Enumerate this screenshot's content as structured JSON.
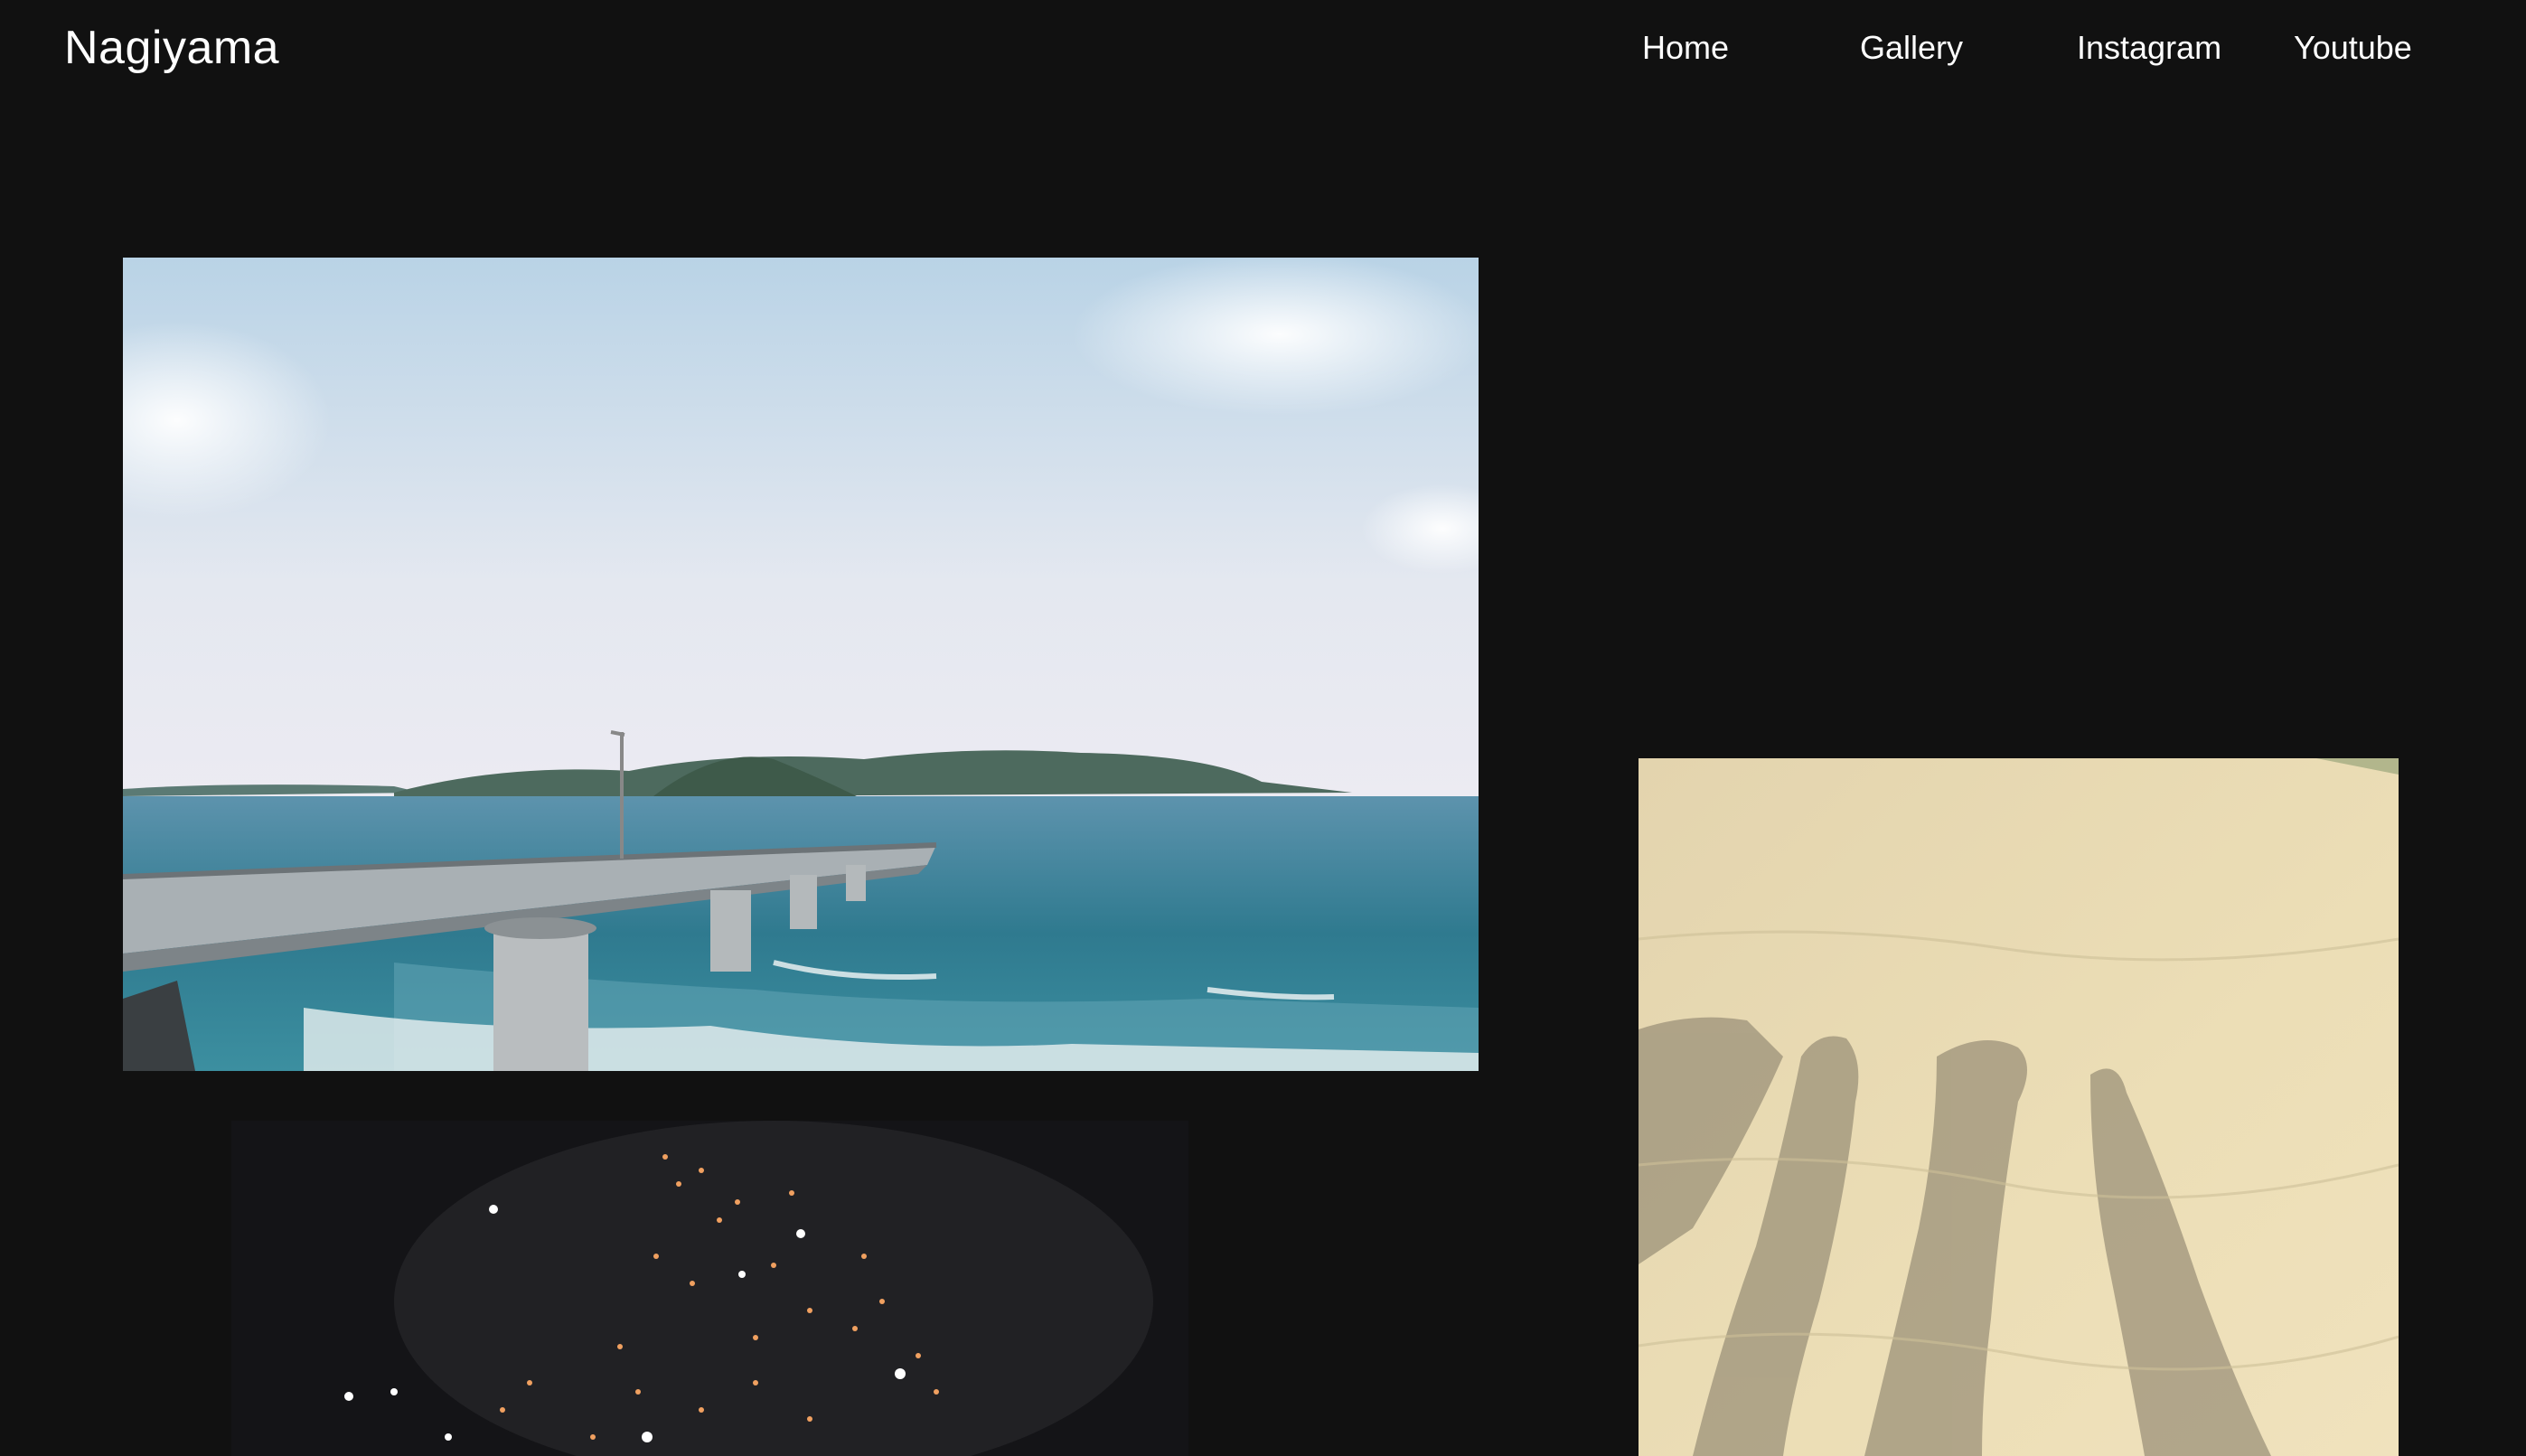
{
  "header": {
    "brand": "Nagiyama",
    "nav": [
      {
        "label": "Home"
      },
      {
        "label": "Gallery"
      },
      {
        "label": "Instagram"
      },
      {
        "label": "Youtube"
      }
    ]
  },
  "colors": {
    "background": "#111111",
    "text": "#ffffff"
  },
  "gallery": {
    "photos": [
      {
        "subject": "sea-bridge-photo"
      },
      {
        "subject": "sand-dune-shadows-photo"
      },
      {
        "subject": "night-lights-photo"
      }
    ]
  }
}
